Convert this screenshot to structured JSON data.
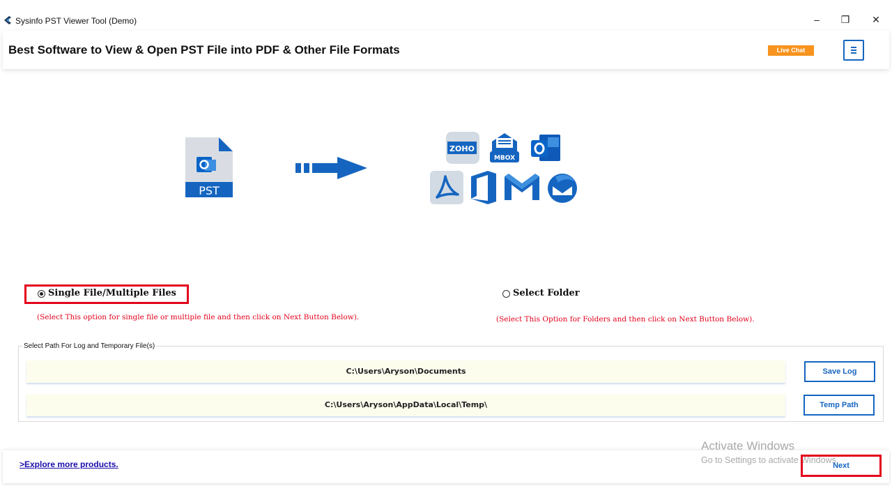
{
  "window": {
    "title": "Sysinfo PST Viewer Tool (Demo)",
    "controls": [
      "–",
      "❐",
      "✕"
    ]
  },
  "header": {
    "title": "Best Software to View & Open PST File into PDF & Other File Formats",
    "live_chat": "Live Chat"
  },
  "graphic": {
    "source_label": "PST",
    "zoho_label": "ZOHO",
    "mbox_label": "MBOX"
  },
  "options": {
    "single": {
      "label": "Single File/Multiple Files",
      "hint": "(Select This option for single file or multiple file and then click on Next Button Below).",
      "selected": true
    },
    "folder": {
      "label": "Select Folder",
      "hint": "(Select This Option for Folders and then click on Next Button Below).",
      "selected": false
    }
  },
  "paths": {
    "legend": "Select Path For Log and Temporary File(s)",
    "log_path": "C:\\Users\\Aryson\\Documents",
    "save_log": "Save Log",
    "temp_path": "C:\\Users\\Aryson\\AppData\\Local\\Temp\\",
    "temp_btn": "Temp Path"
  },
  "footer": {
    "explore": ">Explore more products.",
    "next": "Next"
  },
  "watermark": {
    "title": "Activate Windows",
    "subtitle": "Go to Settings to activate Windows."
  },
  "colors": {
    "accent": "#1565c0",
    "live_chat": "#f7931e",
    "highlight": "#e3001b",
    "hint": "#e3001b"
  },
  "icons": [
    "app-logo",
    "pst-file-icon",
    "arrow-right-icon",
    "zoho-icon",
    "mbox-icon",
    "outlook-icon",
    "pdf-icon",
    "office365-icon",
    "gmail-icon",
    "thunderbird-icon",
    "hamburger-menu-icon"
  ]
}
